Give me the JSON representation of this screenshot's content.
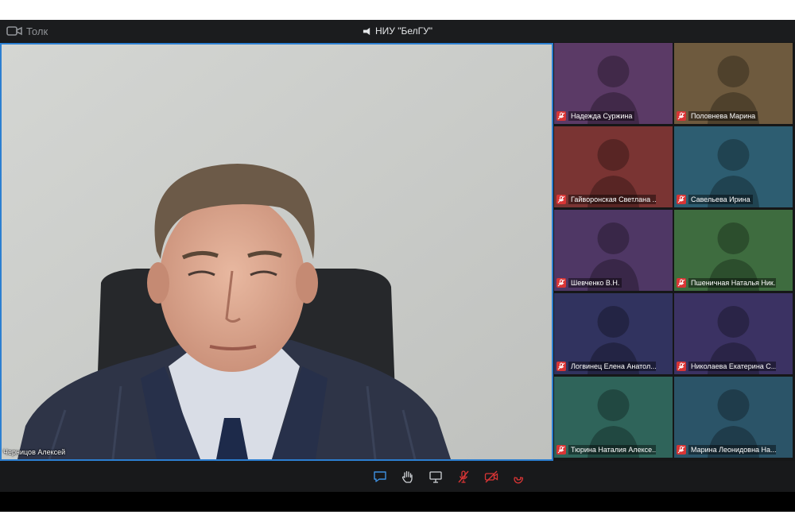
{
  "app": {
    "name": "Толк"
  },
  "conference": {
    "title": "НИУ \"БелГУ\""
  },
  "speaker": {
    "name": "Черницов Алексей"
  },
  "participants": [
    {
      "name": "Надежда Суржина",
      "color": "#5b3a66"
    },
    {
      "name": "Половнева Марина",
      "color": "#6e5a3e"
    },
    {
      "name": "Гайворонская Светлана ...",
      "color": "#7a3433"
    },
    {
      "name": "Савельева Ирина",
      "color": "#2d5d71"
    },
    {
      "name": "Шевченко В.Н.",
      "color": "#4f3765"
    },
    {
      "name": "Пшеничная Наталья Ник...",
      "color": "#3e6c3f"
    },
    {
      "name": "Логвинец Елена Анатол...",
      "color": "#31335f"
    },
    {
      "name": "Николаева Екатерина С...",
      "color": "#3b3263"
    },
    {
      "name": "Тюрина Наталия Алексе...",
      "color": "#2f645a"
    },
    {
      "name": "Марина Леонидовна На...",
      "color": "#2b5468"
    }
  ],
  "toolbar": {
    "icons": [
      "chat-icon",
      "raise-hand-icon",
      "screen-share-icon",
      "mic-muted-icon",
      "camera-off-icon",
      "hang-up-icon"
    ]
  },
  "colors": {
    "accent": "#2c7fd1",
    "danger": "#d93535",
    "bar": "#18191b"
  }
}
